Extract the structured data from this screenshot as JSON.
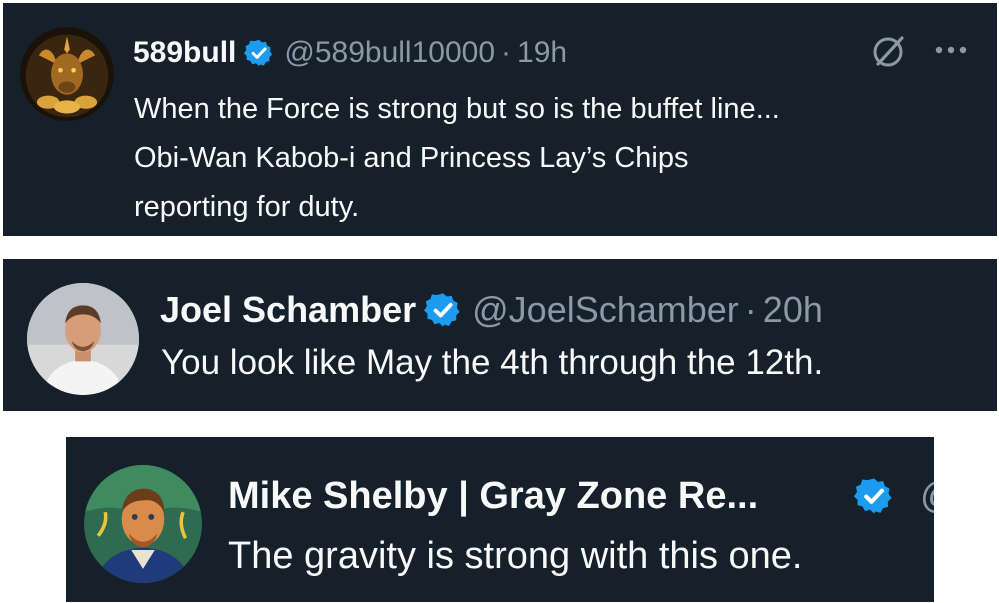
{
  "tweets": [
    {
      "display_name": "589bull",
      "handle": "@589bull10000",
      "separator": "·",
      "time": "19h",
      "text_lines": [
        "When the Force is strong but so is the buffet line...",
        "Obi-Wan Kabob-i and Princess Lay’s Chips",
        "reporting for duty."
      ],
      "avatar_icon": "bull-avatar-icon",
      "action_icons": [
        "grok-icon",
        "more-icon"
      ]
    },
    {
      "display_name": "Joel Schamber",
      "handle": "@JoelSchamber",
      "separator": "·",
      "time": "20h",
      "text_lines": [
        "You look like May the 4th through the 12th."
      ],
      "avatar_icon": "person-avatar-icon"
    },
    {
      "display_name": "Mike Shelby | Gray Zone Re...",
      "handle_cut": "@",
      "text_lines": [
        "The gravity is strong with this one."
      ],
      "avatar_icon": "painted-portrait-avatar-icon"
    }
  ],
  "colors": {
    "card_bg": "#15202b",
    "text": "#f7f9f9",
    "muted": "#8b98a5",
    "verified": "#1d9bf0"
  }
}
